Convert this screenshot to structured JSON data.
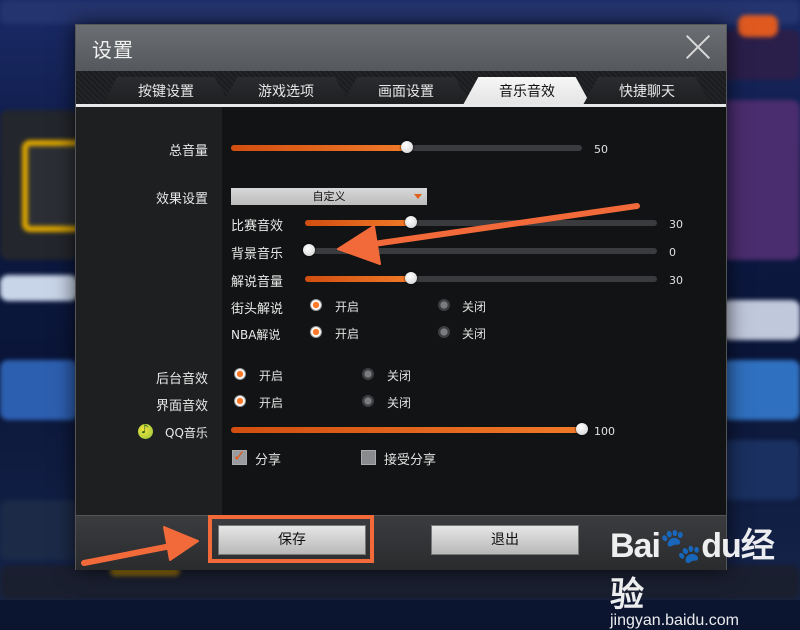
{
  "window": {
    "title": "设置"
  },
  "tabs": [
    {
      "label": "按键设置",
      "active": false
    },
    {
      "label": "游戏选项",
      "active": false
    },
    {
      "label": "画面设置",
      "active": false
    },
    {
      "label": "音乐音效",
      "active": true
    },
    {
      "label": "快捷聊天",
      "active": false
    }
  ],
  "master_volume": {
    "label": "总音量",
    "value": 50,
    "display": "50"
  },
  "effects": {
    "label": "效果设置",
    "preset": "自定义",
    "game_sfx": {
      "label": "比赛音效",
      "value": 30,
      "display": "30"
    },
    "bgm": {
      "label": "背景音乐",
      "value": 0,
      "display": "0"
    },
    "commentary": {
      "label": "解说音量",
      "value": 30,
      "display": "30"
    },
    "street_commentary": {
      "label": "街头解说",
      "on": "开启",
      "off": "关闭",
      "selected": "on"
    },
    "nba_commentary": {
      "label": "NBA解说",
      "on": "开启",
      "off": "关闭",
      "selected": "on"
    }
  },
  "background_sfx": {
    "label": "后台音效",
    "on": "开启",
    "off": "关闭",
    "selected": "on"
  },
  "ui_sfx": {
    "label": "界面音效",
    "on": "开启",
    "off": "关闭",
    "selected": "on"
  },
  "qq_music": {
    "label": "QQ音乐",
    "value": 100,
    "display": "100",
    "icon": "qq-music-icon"
  },
  "share": {
    "label": "分享",
    "checked": true
  },
  "accept_share": {
    "label": "接受分享",
    "checked": false
  },
  "buttons": {
    "save": "保存",
    "exit": "退出"
  },
  "watermark": {
    "logo_a": "Bai",
    "logo_b": "du",
    "logo_c": "经验",
    "url": "jingyan.baidu.com"
  },
  "colors": {
    "accent": "#f07a28",
    "annotation": "#f26a3a"
  }
}
